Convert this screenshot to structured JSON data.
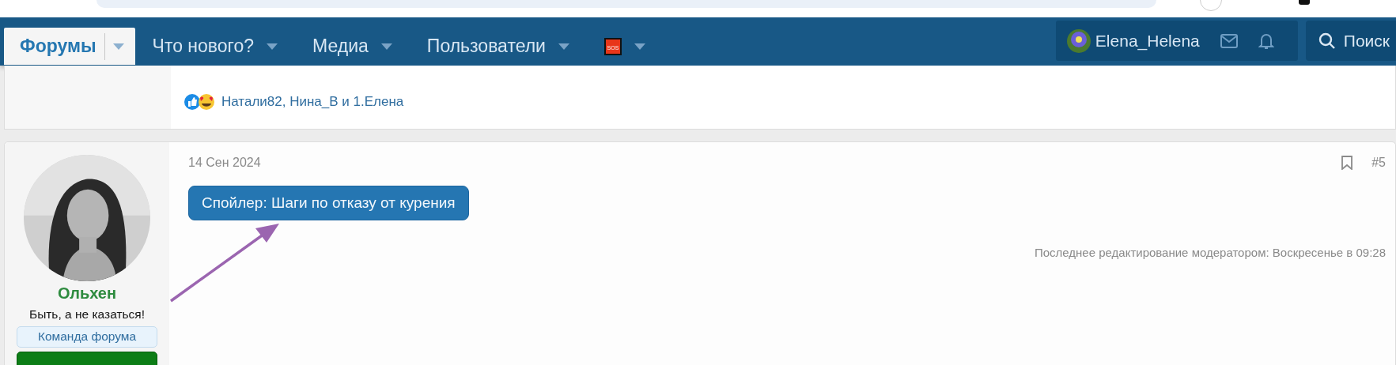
{
  "nav": {
    "items": [
      {
        "label": "Форумы",
        "selected": true,
        "kind": "text"
      },
      {
        "label": "Что нового?",
        "selected": false,
        "kind": "text"
      },
      {
        "label": "Медиа",
        "selected": false,
        "kind": "text"
      },
      {
        "label": "Пользователи",
        "selected": false,
        "kind": "text"
      },
      {
        "label": "SOS",
        "selected": false,
        "kind": "icon"
      }
    ],
    "user": {
      "name": "Elena_Helena"
    },
    "search": {
      "label": "Поиск"
    }
  },
  "previous_post": {
    "reactions": "Натали82, Нина_В и 1.Елена"
  },
  "post": {
    "author": {
      "name": "Ольхен",
      "title": "Быть, а не казаться!",
      "badges": [
        {
          "label": "Команда форума",
          "kind": "light"
        },
        {
          "kind": "green"
        }
      ]
    },
    "date": "14 Сен 2024",
    "number": "#5",
    "spoiler": "Спойлер: Шаги по отказу от курения",
    "edit_note": "Последнее редактирование модератором: Воскресенье в 09:28"
  }
}
